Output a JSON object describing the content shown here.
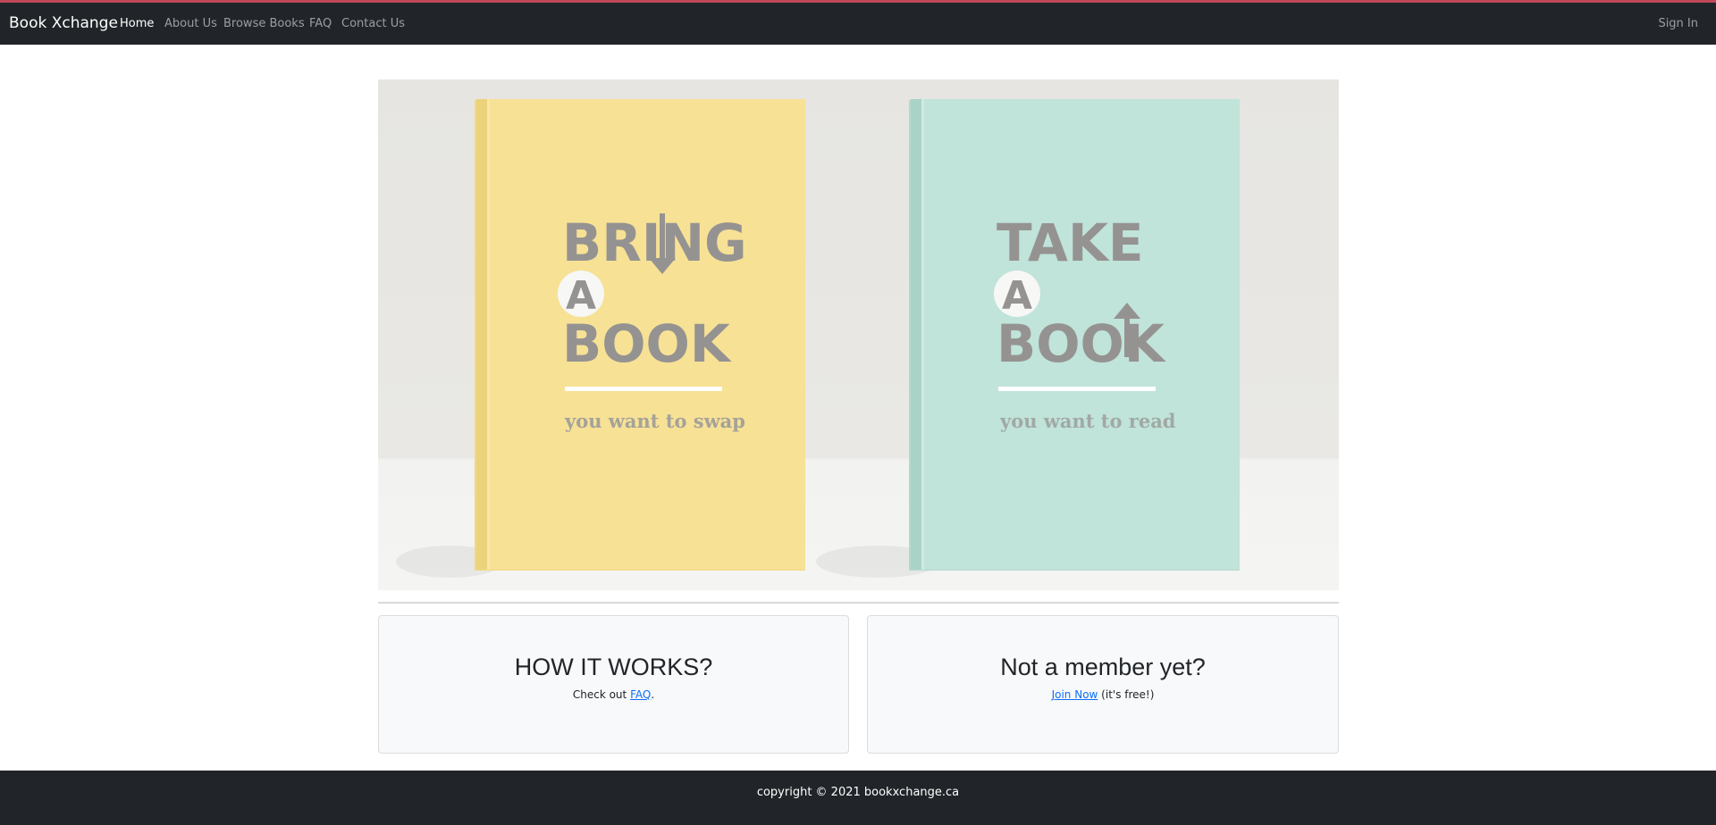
{
  "navbar": {
    "brand": "Book Xchange",
    "links": [
      {
        "label": "Home",
        "active": true
      },
      {
        "label": "About Us",
        "active": false
      },
      {
        "label": "Browse Books",
        "active": false
      },
      {
        "label": "FAQ",
        "active": false
      },
      {
        "label": "Contact Us",
        "active": false
      }
    ],
    "sign_in": "Sign In"
  },
  "hero": {
    "left_book": {
      "line1": "BRING",
      "line2": "A",
      "line3": "BOOK",
      "subtitle": "you want to swap",
      "color": "#f7e195"
    },
    "right_book": {
      "line1": "TAKE",
      "line2": "A",
      "line3": "BOOK",
      "subtitle": "you want to read",
      "color": "#c0e3da"
    }
  },
  "cards": {
    "how": {
      "title": "HOW IT WORKS?",
      "text_prefix": "Check out ",
      "link": "FAQ",
      "text_suffix": "."
    },
    "member": {
      "title": "Not a member yet?",
      "link": "Join Now",
      "text_suffix": " (it's free!)"
    }
  },
  "footer": {
    "text": "copyright © 2021 bookxchange.ca"
  },
  "colors": {
    "navbar": "#212529",
    "accent_line": "#c0485a",
    "link": "#0d6efd"
  }
}
